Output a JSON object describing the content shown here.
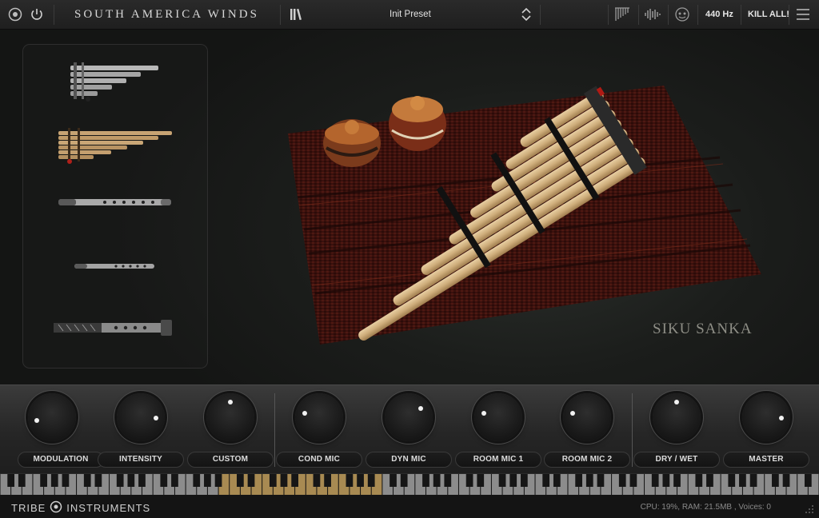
{
  "topbar": {
    "title": "SOUTH AMERICA WINDS",
    "preset": "Init Preset",
    "tuning": "440 Hz",
    "kill_all": "KILL ALL!",
    "icons": [
      "logo-icon",
      "power-icon",
      "library-icon",
      "preset-arrows-icon",
      "panpipe-icon",
      "waveform-icon",
      "mask-icon",
      "menu-icon"
    ]
  },
  "instrument": {
    "name": "SIKU SANKA",
    "list": [
      "siku-sanka",
      "zampona",
      "quena",
      "quenacho",
      "tarka"
    ],
    "selected": 1
  },
  "knobs": [
    {
      "label": "MODULATION",
      "value": 0.12
    },
    {
      "label": "INTENSITY",
      "value": 0.85
    },
    {
      "label": "CUSTOM",
      "value": 0.5
    },
    {
      "label": "COND MIC",
      "value": 0.22
    },
    {
      "label": "DYN MIC",
      "value": 0.7
    },
    {
      "label": "ROOM MIC 1",
      "value": 0.22
    },
    {
      "label": "ROOM MIC 2",
      "value": 0.22
    },
    {
      "label": "DRY / WET",
      "value": 0.5
    },
    {
      "label": "MASTER",
      "value": 0.85
    }
  ],
  "footer": {
    "brand_left": "TRIBE",
    "brand_right": "INSTRUMENTS",
    "status": "CPU: 19%, RAM: 21.5MB , Voices: 0"
  },
  "colors": {
    "accent_key": "#a88a52",
    "knob_dot": "#f1f1f1",
    "rug": "#3a100c"
  }
}
